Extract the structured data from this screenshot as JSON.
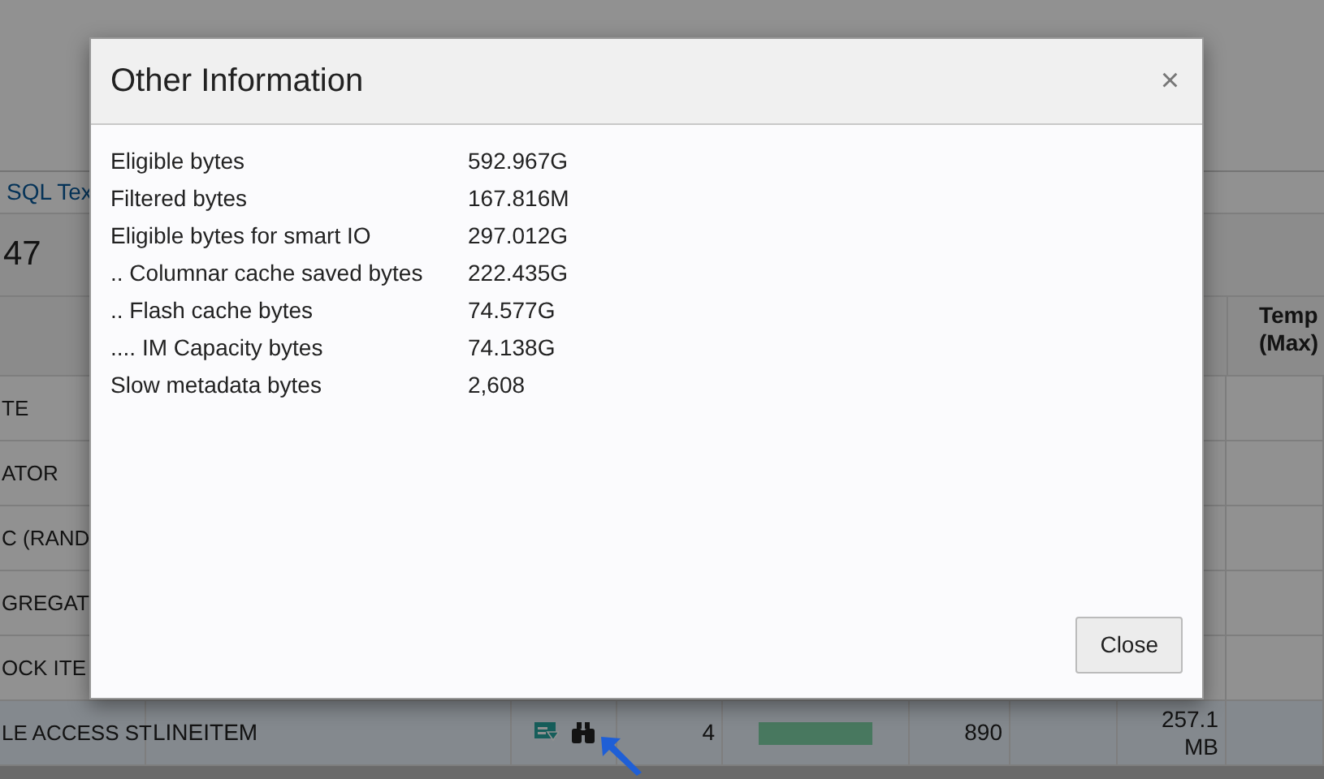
{
  "background": {
    "tab_link": "SQL Tex",
    "heading": "47",
    "header_cell": "Temp (Max)",
    "rows": [
      {
        "operation": "TE",
        "selected": false
      },
      {
        "operation": "ATOR",
        "selected": false
      },
      {
        "operation": "C (RAND",
        "selected": false
      },
      {
        "operation": "GREGAT",
        "selected": false
      },
      {
        "operation": "OCK ITE",
        "selected": false
      },
      {
        "operation": "LE ACCESS ST",
        "object": "LINEITEM",
        "count": "4",
        "level": 1,
        "rows_value": "890",
        "memory": "257.1 MB",
        "selected": true
      }
    ]
  },
  "dialog": {
    "title": "Other Information",
    "close_symbol": "×",
    "items": [
      {
        "label": "Eligible bytes",
        "value": "592.967G"
      },
      {
        "label": "Filtered bytes",
        "value": "167.816M"
      },
      {
        "label": "Eligible bytes for smart IO",
        "value": "297.012G"
      },
      {
        "label": ".. Columnar cache saved bytes",
        "value": "222.435G"
      },
      {
        "label": ".. Flash cache bytes",
        "value": "74.577G"
      },
      {
        "label": ".... IM Capacity bytes",
        "value": "74.138G"
      },
      {
        "label": "Slow metadata bytes",
        "value": "2,608"
      }
    ],
    "button": "Close"
  }
}
